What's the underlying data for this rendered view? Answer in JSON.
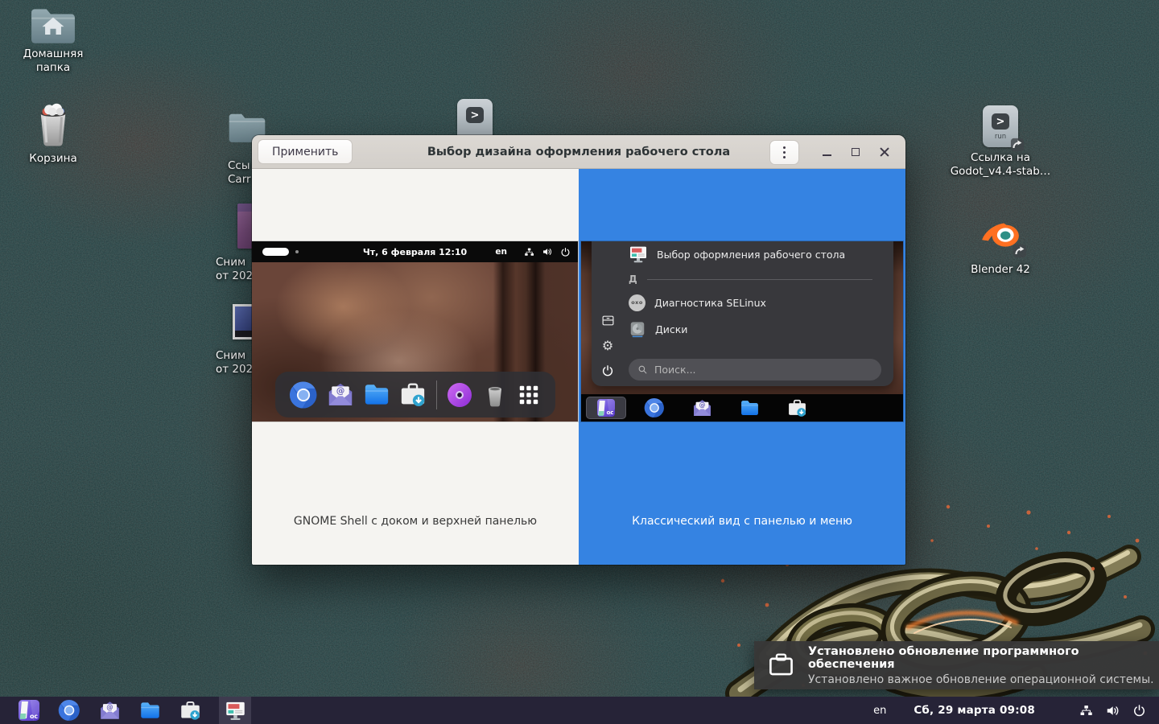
{
  "desktop": {
    "run_badge": "run",
    "icons": {
      "home": {
        "label": "Домашняя папка"
      },
      "trash": {
        "label": "Корзина"
      },
      "clipped_folder": {
        "line1": "Ссы",
        "line2": "Carr"
      },
      "screenshot1": {
        "line1": "Сним",
        "line2": "от 202"
      },
      "screenshot2": {
        "line1": "Сним",
        "line2": "от 202"
      },
      "godot_link": {
        "line1": "Ссылка на",
        "line2": "Godot_v4.4-stab…"
      },
      "blender": {
        "label": "Blender 42"
      }
    }
  },
  "window": {
    "title": "Выбор дизайна оформления рабочего стола",
    "apply_button": "Применить",
    "gnome_panel": {
      "caption": "GNOME Shell с доком и верхней панелью",
      "clock": "Чт, 6 февраля 12:10",
      "lang": "en"
    },
    "classic_panel": {
      "caption": "Классический вид с панелью и меню",
      "menu": {
        "app_item": "Выбор оформления рабочего стола",
        "section_label": "Д",
        "item_selinux": "Диагностика SELinux",
        "item_disks": "Диски",
        "search_placeholder": "Поиск...",
        "oxo_text": "oxo"
      },
      "start_label": "ос"
    }
  },
  "notification": {
    "title": "Установлено обновление программного обеспечения",
    "body": "Установлено важное обновление операционной системы."
  },
  "taskbar": {
    "lang": "en",
    "clock": "Сб, 29 марта 09:08",
    "start_label": "ос"
  },
  "colors": {
    "accent_blue": "#3584e4",
    "taskbar_bg": "#262337",
    "titlebar_bg": "#d8d4cf",
    "notification_bg": "#383838"
  }
}
